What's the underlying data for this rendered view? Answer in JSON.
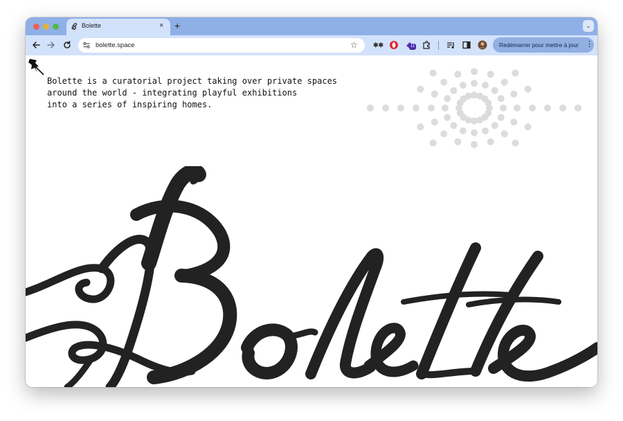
{
  "browser": {
    "tab": {
      "title": "Bolette",
      "close": "×",
      "favicon": "bolette-favicon-icon"
    },
    "new_tab": "+",
    "tab_search": "⌄",
    "address_bar": {
      "url": "bolette.space"
    },
    "toolbar": {
      "back": "back-arrow-icon",
      "forward": "forward-arrow-icon",
      "reload": "reload-icon",
      "bookmark": "star-icon",
      "relaunch_label": "Redémarrer pour mettre à jour",
      "extension_badge": "11"
    }
  },
  "page": {
    "intro_lines": [
      "Bolette is a curatorial project taking over private spaces",
      "around the world - integrating playful exhibitions",
      "into a series of inspiring homes."
    ],
    "logo_text": "Bolette"
  },
  "colors": {
    "tabstrip": "#8fb0e6",
    "toolbar": "#d3e2fb",
    "relaunch_button": "#92afe2",
    "ink": "#222222",
    "dot": "#dcdcdc"
  }
}
